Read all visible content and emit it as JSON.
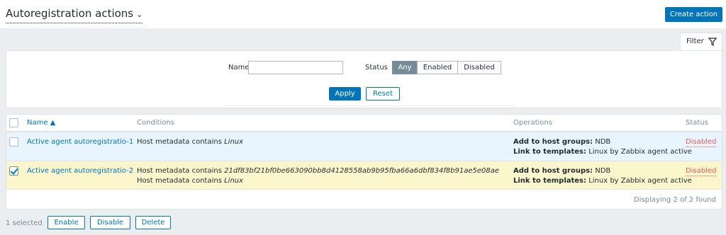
{
  "page": {
    "title": "Autoregistration actions"
  },
  "header": {
    "create_button": "Create action"
  },
  "filter": {
    "tab_label": "Filter",
    "name_label": "Name",
    "name_value": "",
    "status_label": "Status",
    "status_options": [
      "Any",
      "Enabled",
      "Disabled"
    ],
    "status_selected": "Any",
    "apply_label": "Apply",
    "reset_label": "Reset"
  },
  "table": {
    "columns": {
      "name": "Name ▲",
      "conditions": "Conditions",
      "operations": "Operations",
      "status": "Status"
    },
    "rows": [
      {
        "checked": false,
        "name": "Active agent autoregistratio-1",
        "conditions": [
          {
            "prefix": "Host metadata contains ",
            "value": "Linux"
          }
        ],
        "operations": [
          {
            "label": "Add to host groups:",
            "value": " NDB"
          },
          {
            "label": "Link to templates:",
            "value": " Linux by Zabbix agent active"
          }
        ],
        "status": "Disabled"
      },
      {
        "checked": true,
        "name": "Active agent autoregistratio-2",
        "conditions": [
          {
            "prefix": "Host metadata contains ",
            "value": "21df83bf21bf0be663090bb8d4128558ab9b95fba66a6dbf834f8b91ae5e08ae"
          },
          {
            "prefix": "Host metadata contains ",
            "value": "Linux"
          }
        ],
        "operations": [
          {
            "label": "Add to host groups:",
            "value": " NDB"
          },
          {
            "label": "Link to templates:",
            "value": " Linux by Zabbix agent active"
          }
        ],
        "status": "Disabled"
      }
    ],
    "footer": "Displaying 2 of 2 found"
  },
  "mass_actions": {
    "selected_count": "1 selected",
    "enable": "Enable",
    "disable": "Disable",
    "delete": "Delete"
  },
  "colors": {
    "accent": "#0275b8",
    "disabled_status": "#e45959",
    "selected_row": "#fbf6cb",
    "hover_row": "#e8f5ff"
  }
}
